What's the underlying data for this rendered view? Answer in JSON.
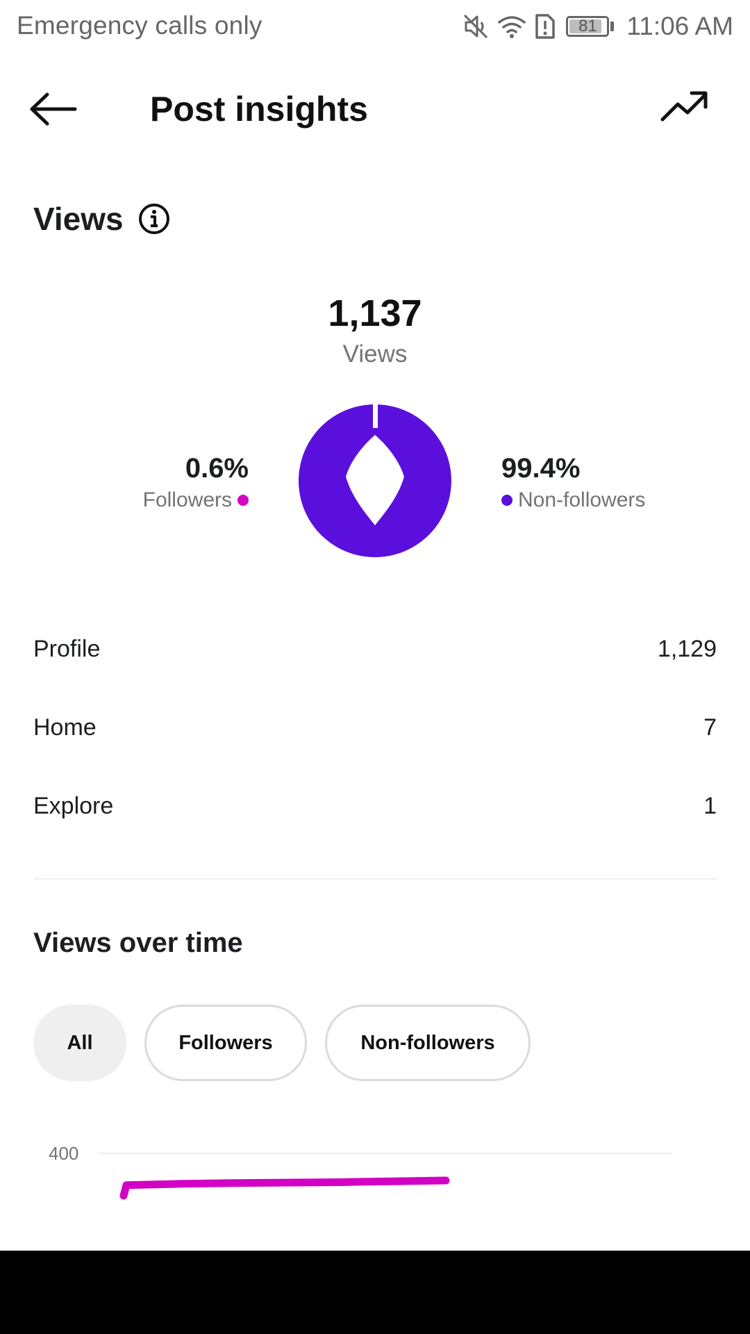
{
  "status_bar": {
    "carrier": "Emergency calls only",
    "battery": "81",
    "time": "11:06 AM"
  },
  "header": {
    "title": "Post insights"
  },
  "views": {
    "title": "Views",
    "total": "1,137",
    "total_label": "Views",
    "followers_pct": "0.6%",
    "followers_label": "Followers",
    "non_followers_pct": "99.4%",
    "non_followers_label": "Non-followers",
    "followers_fraction": 0.006,
    "colors": {
      "followers": "#d300c5",
      "non_followers": "#5b0fdc"
    }
  },
  "sources": [
    {
      "label": "Profile",
      "value": "1,129"
    },
    {
      "label": "Home",
      "value": "7"
    },
    {
      "label": "Explore",
      "value": "1"
    }
  ],
  "views_over_time": {
    "title": "Views over time",
    "filters": [
      "All",
      "Followers",
      "Non-followers"
    ],
    "active_filter": "All"
  },
  "chart_data": {
    "type": "line",
    "y_ticks": [
      "400"
    ],
    "series": [
      {
        "color": "#d300c5",
        "values": [
          300,
          325,
          328,
          330,
          331,
          332,
          334,
          336
        ]
      }
    ],
    "ylim": [
      0,
      400
    ],
    "grid": true
  }
}
